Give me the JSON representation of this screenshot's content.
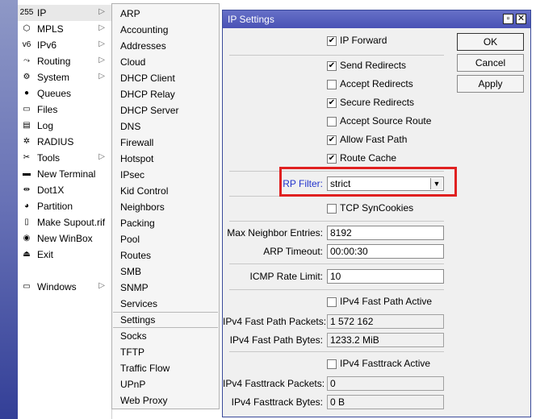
{
  "colors": {
    "rp_filter_label": "#2233cc",
    "highlight": "#e02020",
    "titlebar": "#5a62bf"
  },
  "main_menu": [
    {
      "label": "IP",
      "icon": "ip-icon",
      "glyph": "255",
      "arrow": true
    },
    {
      "label": "MPLS",
      "icon": "mpls-icon",
      "glyph": "⬡",
      "arrow": true
    },
    {
      "label": "IPv6",
      "icon": "ipv6-icon",
      "glyph": "v6",
      "arrow": true
    },
    {
      "label": "Routing",
      "icon": "routing-icon",
      "glyph": "⤳",
      "arrow": true
    },
    {
      "label": "System",
      "icon": "system-icon",
      "glyph": "⚙",
      "arrow": true
    },
    {
      "label": "Queues",
      "icon": "queues-icon",
      "glyph": "●",
      "arrow": false
    },
    {
      "label": "Files",
      "icon": "files-icon",
      "glyph": "▭",
      "arrow": false
    },
    {
      "label": "Log",
      "icon": "log-icon",
      "glyph": "▤",
      "arrow": false
    },
    {
      "label": "RADIUS",
      "icon": "radius-icon",
      "glyph": "✲",
      "arrow": false
    },
    {
      "label": "Tools",
      "icon": "tools-icon",
      "glyph": "✂",
      "arrow": true
    },
    {
      "label": "New Terminal",
      "icon": "terminal-icon",
      "glyph": "▬",
      "arrow": false
    },
    {
      "label": "Dot1X",
      "icon": "dot1x-icon",
      "glyph": "⇹",
      "arrow": false
    },
    {
      "label": "Partition",
      "icon": "partition-icon",
      "glyph": "◕",
      "arrow": false
    },
    {
      "label": "Make Supout.rif",
      "icon": "supout-icon",
      "glyph": "▯",
      "arrow": false
    },
    {
      "label": "New WinBox",
      "icon": "winbox-icon",
      "glyph": "◉",
      "arrow": false
    },
    {
      "label": "Exit",
      "icon": "exit-icon",
      "glyph": "⏏",
      "arrow": false
    },
    {
      "label": "Windows",
      "icon": "windows-icon",
      "glyph": "▭",
      "arrow": true
    }
  ],
  "sub_menu": [
    "ARP",
    "Accounting",
    "Addresses",
    "Cloud",
    "DHCP Client",
    "DHCP Relay",
    "DHCP Server",
    "DNS",
    "Firewall",
    "Hotspot",
    "IPsec",
    "Kid Control",
    "Neighbors",
    "Packing",
    "Pool",
    "Routes",
    "SMB",
    "SNMP",
    "Services",
    "Settings",
    "Socks",
    "TFTP",
    "Traffic Flow",
    "UPnP",
    "Web Proxy"
  ],
  "sub_menu_selected": "Settings",
  "dialog": {
    "title": "IP Settings",
    "buttons": {
      "ok": "OK",
      "cancel": "Cancel",
      "apply": "Apply"
    },
    "checkboxes": {
      "ip_forward": {
        "label": "IP Forward",
        "checked": true
      },
      "send_redirects": {
        "label": "Send Redirects",
        "checked": true
      },
      "accept_redirects": {
        "label": "Accept Redirects",
        "checked": false
      },
      "secure_redirects": {
        "label": "Secure Redirects",
        "checked": true
      },
      "accept_source_route": {
        "label": "Accept Source Route",
        "checked": false
      },
      "allow_fast_path": {
        "label": "Allow Fast Path",
        "checked": true
      },
      "route_cache": {
        "label": "Route Cache",
        "checked": true
      },
      "tcp_syncookies": {
        "label": "TCP SynCookies",
        "checked": false
      },
      "ipv4_fast_path_active": {
        "label": "IPv4 Fast Path Active",
        "checked": false
      },
      "ipv4_fasttrack_active": {
        "label": "IPv4 Fasttrack Active",
        "checked": false
      }
    },
    "rp_filter": {
      "label": "RP Filter:",
      "value": "strict"
    },
    "fields": {
      "max_neighbor_entries": {
        "label": "Max Neighbor Entries:",
        "value": "8192"
      },
      "arp_timeout": {
        "label": "ARP Timeout:",
        "value": "00:00:30"
      },
      "icmp_rate_limit": {
        "label": "ICMP Rate Limit:",
        "value": "10"
      },
      "ipv4_fast_path_packets": {
        "label": "IPv4 Fast Path Packets:",
        "value": "1 572 162"
      },
      "ipv4_fast_path_bytes": {
        "label": "IPv4 Fast Path Bytes:",
        "value": "1233.2 MiB"
      },
      "ipv4_fasttrack_packets": {
        "label": "IPv4 Fasttrack Packets:",
        "value": "0"
      },
      "ipv4_fasttrack_bytes": {
        "label": "IPv4 Fasttrack Bytes:",
        "value": "0 B"
      }
    }
  }
}
